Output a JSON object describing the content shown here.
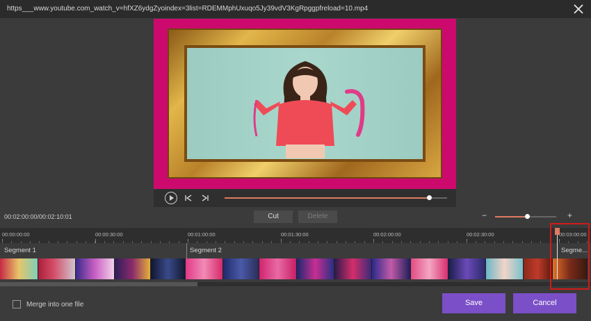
{
  "window": {
    "title": "https___www.youtube.com_watch_v=hfXZ6ydgZyoindex=3list=RDEMMphUxuqo5Jy39vdV3KgRpggpfreload=10.mp4"
  },
  "player": {
    "progress": 0.92,
    "controls": {
      "play_icon": "play-icon",
      "prev_icon": "skip-back-icon",
      "next_icon": "skip-forward-icon"
    }
  },
  "toolbar": {
    "timecode": "00:02:00:00/00:02:10:01",
    "cut_label": "Cut",
    "delete_label": "Delete",
    "zoom_minus": "−",
    "zoom_plus": "+",
    "zoom_level": 0.52
  },
  "ruler": {
    "ticks": [
      "00:00:00:00",
      "00:00:30:00",
      "00:01:00:00",
      "00:01:30:00",
      "00:02:00:00",
      "00:02:30:00",
      "00:03:00:00"
    ]
  },
  "segments": [
    {
      "label": "Segment 1"
    },
    {
      "label": "Segment 2"
    },
    {
      "label": "Segme..."
    }
  ],
  "footer": {
    "merge_label": "Merge into one file",
    "save_label": "Save",
    "cancel_label": "Cancel"
  },
  "colors": {
    "accent": "#7b4fc8",
    "highlight": "#d31a1a",
    "playhead": "#e07a62",
    "preview_bg": "#cc0a6e"
  }
}
